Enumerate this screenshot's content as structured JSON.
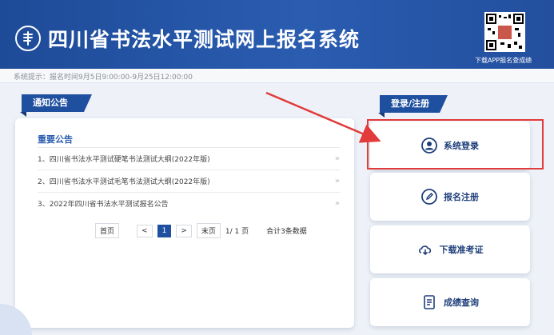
{
  "header": {
    "title": "四川省书法水平测试网上报名系统",
    "qr_caption": "下载APP报名查成绩"
  },
  "hint": {
    "text": "系统提示：报名时间9月5日9:00:00-9月25日12:00:00"
  },
  "notice": {
    "tab_label": "通知公告",
    "heading": "重要公告",
    "items": [
      {
        "text": "1、四川省书法水平测试硬笔书法测试大纲(2022年版)",
        "arrow": "»"
      },
      {
        "text": "2、四川省书法水平测试毛笔书法测试大纲(2022年版)",
        "arrow": "»"
      },
      {
        "text": "3、2022年四川省书法水平测试报名公告",
        "arrow": "»"
      }
    ],
    "pager": {
      "first": "首页",
      "prev": "<",
      "current": "1",
      "next": ">",
      "last": "末页",
      "page_info": "1/ 1 页",
      "total": "合计3条数据"
    }
  },
  "login": {
    "tab_label": "登录/注册",
    "actions": [
      {
        "label": "系统登录",
        "icon": "user-icon"
      },
      {
        "label": "报名注册",
        "icon": "edit-icon"
      },
      {
        "label": "下载准考证",
        "icon": "cloud-download-icon"
      },
      {
        "label": "成绩查询",
        "icon": "document-icon"
      }
    ]
  },
  "colors": {
    "brand": "#1f4f9f",
    "annotation": "#e23b3b"
  }
}
